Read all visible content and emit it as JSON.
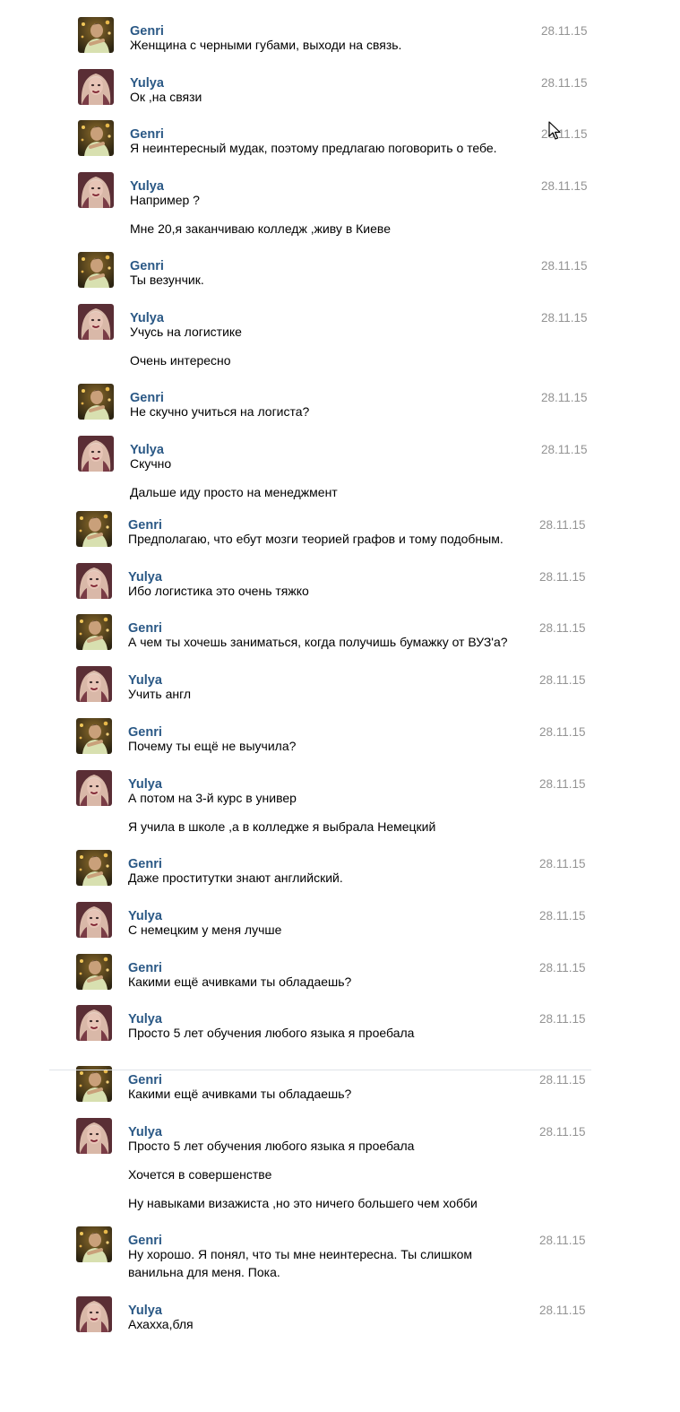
{
  "conversation": {
    "messages": [
      {
        "author": "Genri",
        "date": "28.11.15",
        "lines": [
          "Женщина с черными губами, выходи на связь."
        ]
      },
      {
        "author": "Yulya",
        "date": "28.11.15",
        "lines": [
          "Ок ,на связи"
        ]
      },
      {
        "author": "Genri",
        "date": "28.11.15",
        "lines": [
          "Я неинтересный мудак, поэтому предлагаю поговорить о тебе."
        ]
      },
      {
        "author": "Yulya",
        "date": "28.11.15",
        "lines": [
          "Например ?",
          "Мне 20,я заканчиваю колледж ,живу в Киеве"
        ]
      },
      {
        "author": "Genri",
        "date": "28.11.15",
        "lines": [
          "Ты везунчик."
        ]
      },
      {
        "author": "Yulya",
        "date": "28.11.15",
        "lines": [
          "Учусь на логистике",
          "Очень интересно"
        ]
      },
      {
        "author": "Genri",
        "date": "28.11.15",
        "lines": [
          "Не скучно учиться на логиста?"
        ]
      },
      {
        "author": "Yulya",
        "date": "28.11.15",
        "lines": [
          "Скучно",
          "Дальше иду просто на менеджмент"
        ]
      },
      {
        "author": "Genri",
        "date": "28.11.15",
        "lines": [
          "Предполагаю, что ебут мозги теорией графов и тому подобным."
        ]
      },
      {
        "author": "Yulya",
        "date": "28.11.15",
        "lines": [
          "Ибо логистика это очень тяжко"
        ]
      },
      {
        "author": "Genri",
        "date": "28.11.15",
        "lines": [
          "А чем ты хочешь заниматься, когда получишь бумажку от ВУЗ'а?"
        ]
      },
      {
        "author": "Yulya",
        "date": "28.11.15",
        "lines": [
          "Учить англ"
        ]
      },
      {
        "author": "Genri",
        "date": "28.11.15",
        "lines": [
          "Почему ты ещё не выучила?"
        ]
      },
      {
        "author": "Yulya",
        "date": "28.11.15",
        "lines": [
          "А потом на 3-й курс в универ",
          "Я учила в школе ,а в колледже я выбрала Немецкий"
        ]
      },
      {
        "author": "Genri",
        "date": "28.11.15",
        "lines": [
          "Даже проститутки знают английский."
        ]
      },
      {
        "author": "Yulya",
        "date": "28.11.15",
        "lines": [
          "С немецким у меня лучше"
        ]
      },
      {
        "author": "Genri",
        "date": "28.11.15",
        "lines": [
          "Какими ещё ачивками ты обладаешь?"
        ]
      },
      {
        "author": "Yulya",
        "date": "28.11.15",
        "lines": [
          "Просто 5 лет обучения любого языка я проебала"
        ]
      },
      {
        "author": "Genri",
        "date": "28.11.15",
        "lines": [
          "Какими ещё ачивками ты обладаешь?"
        ]
      },
      {
        "author": "Yulya",
        "date": "28.11.15",
        "lines": [
          "Просто 5 лет обучения любого языка я проебала",
          "Хочется в совершенстве",
          "Ну навыками визажиста ,но это ничего большего чем хобби"
        ]
      },
      {
        "author": "Genri",
        "date": "28.11.15",
        "lines": [
          "Ну хорошо. Я понял, что ты мне неинтересна. Ты слишком",
          "ванильна для меня. Пока."
        ]
      },
      {
        "author": "Yulya",
        "date": "28.11.15",
        "lines": [
          "Ахахха,бля"
        ]
      }
    ]
  }
}
